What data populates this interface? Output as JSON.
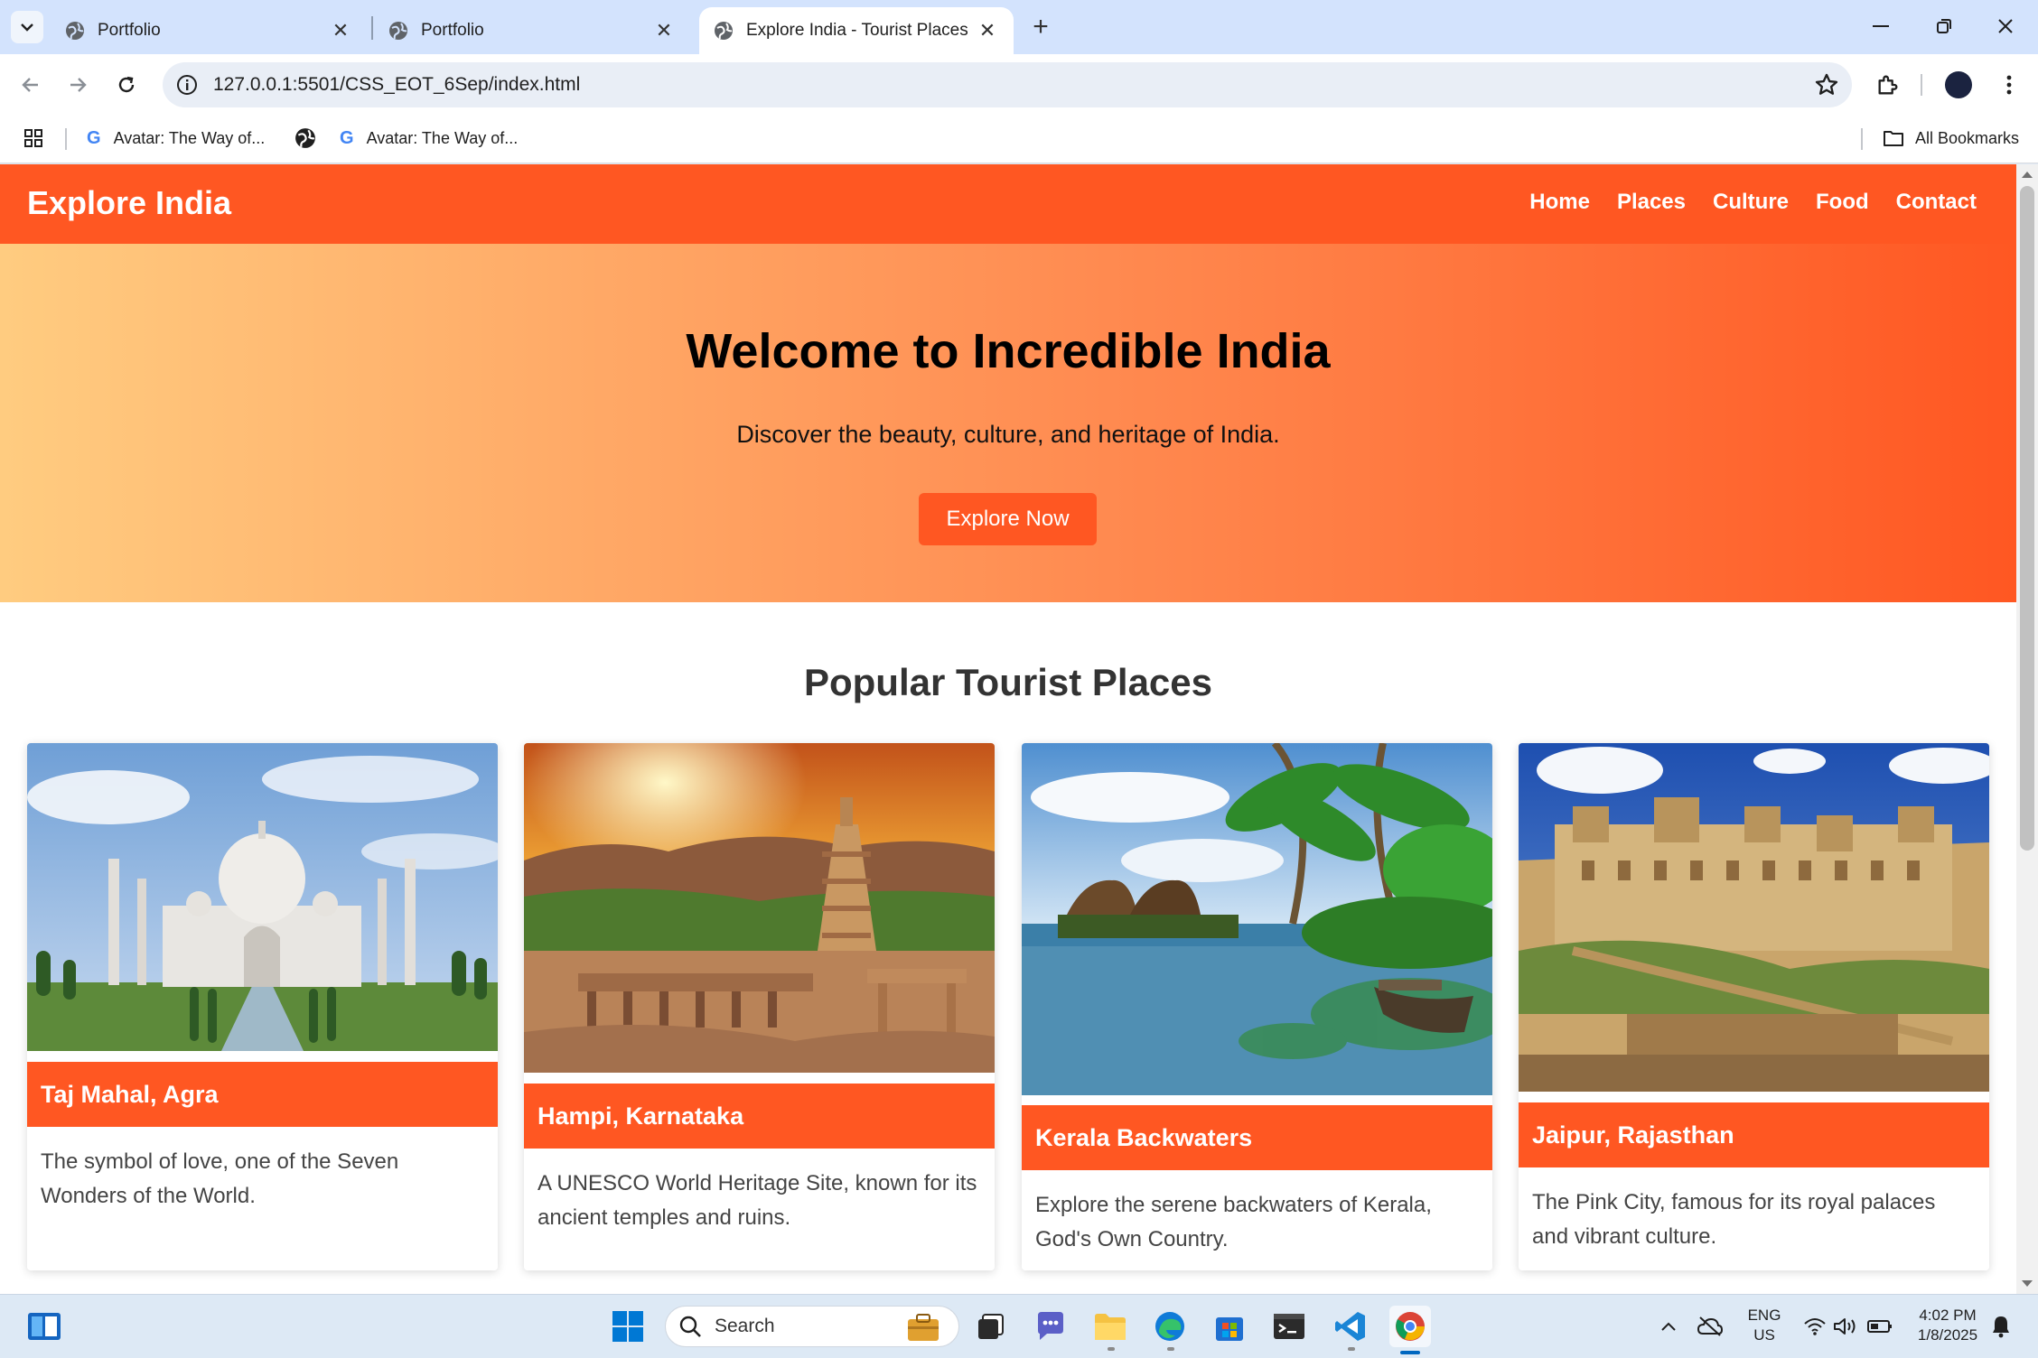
{
  "browser": {
    "tabs": [
      {
        "title": "Portfolio",
        "active": false
      },
      {
        "title": "Portfolio",
        "active": false
      },
      {
        "title": "Explore India - Tourist Places",
        "active": true
      }
    ],
    "url": "127.0.0.1:5501/CSS_EOT_6Sep/index.html",
    "bookmarks": [
      {
        "label": "Avatar: The Way of..."
      },
      {
        "label": "Avatar: The Way of..."
      }
    ],
    "all_bookmarks_label": "All Bookmarks"
  },
  "site": {
    "logo": "Explore India",
    "nav": [
      "Home",
      "Places",
      "Culture",
      "Food",
      "Contact"
    ],
    "hero": {
      "title": "Welcome to Incredible India",
      "subtitle": "Discover the beauty, culture, and heritage of India.",
      "button": "Explore Now"
    },
    "section_title": "Popular Tourist Places",
    "places": [
      {
        "name": "Taj Mahal, Agra",
        "description": "The symbol of love, one of the Seven Wonders of the World."
      },
      {
        "name": "Hampi, Karnataka",
        "description": "A UNESCO World Heritage Site, known for its ancient temples and ruins."
      },
      {
        "name": "Kerala Backwaters",
        "description": "Explore the serene backwaters of Kerala, God's Own Country."
      },
      {
        "name": "Jaipur, Rajasthan",
        "description": "The Pink City, famous for its royal palaces and vibrant culture."
      }
    ],
    "colors": {
      "accent": "#ff5722",
      "hero_start": "#ffcc80",
      "hero_end": "#ff5722"
    }
  },
  "taskbar": {
    "search_placeholder": "Search",
    "language": "ENG",
    "region": "US",
    "time": "4:02 PM",
    "date": "1/8/2025"
  }
}
